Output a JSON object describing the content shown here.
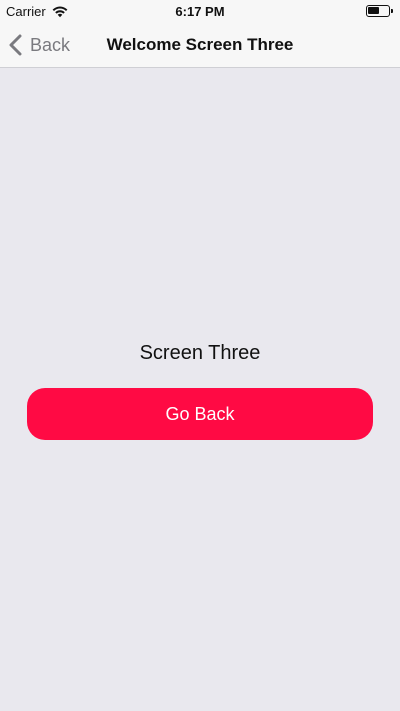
{
  "status_bar": {
    "carrier": "Carrier",
    "time": "6:17 PM"
  },
  "nav": {
    "back_label": "Back",
    "title": "Welcome Screen Three"
  },
  "main": {
    "screen_label": "Screen Three",
    "go_back_label": "Go Back"
  },
  "colors": {
    "accent_button": "#ff0a44",
    "background": "#e9e8ee",
    "bar_background": "#f7f7f7",
    "back_text": "#7a7a7f"
  },
  "icons": [
    "wifi-icon",
    "battery-icon",
    "chevron-left-icon"
  ]
}
